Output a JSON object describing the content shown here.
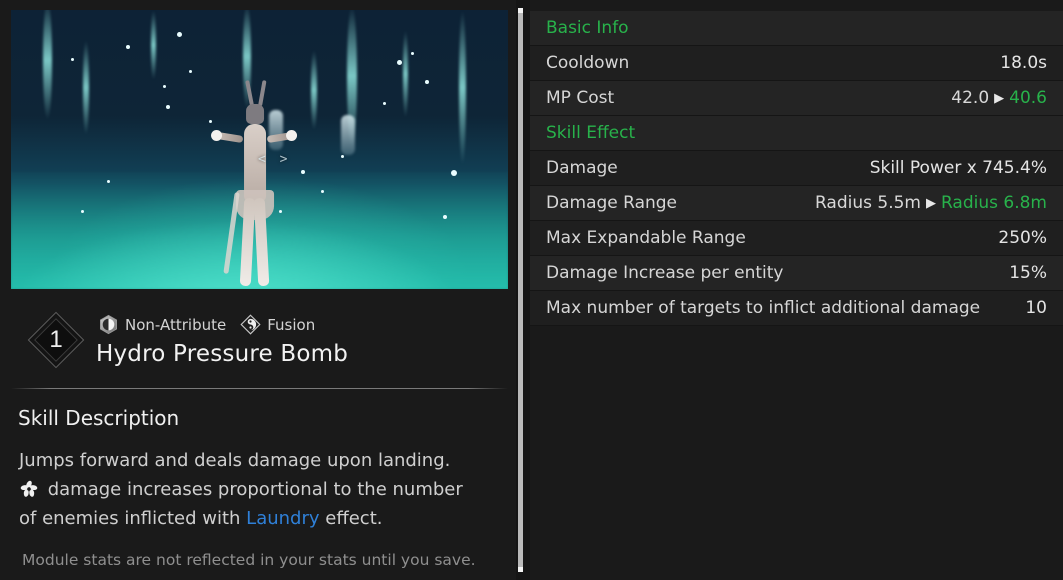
{
  "left": {
    "video": {
      "name": "skill-preview-video",
      "seek_marker": "< >"
    },
    "level_badge": "1",
    "attributes": [
      {
        "icon": "hexagon-non-attribute-icon",
        "label": "Non-Attribute"
      },
      {
        "icon": "diamond-fusion-icon",
        "label": "Fusion"
      }
    ],
    "skill_name": "Hydro Pressure Bomb",
    "description_title": "Skill Description",
    "description_lines": [
      "Jumps forward and deals damage upon landing.",
      "[icon] damage increases proportional to the number",
      "of enemies inflicted with Laundry effect."
    ],
    "description_line_1": "Jumps forward and deals damage upon landing.",
    "description_line_2_after_icon": " damage increases proportional to the number",
    "description_line_3_pre": "of enemies inflicted with ",
    "description_link": "Laundry",
    "description_line_3_post": " effect.",
    "footer_note": "Module stats are not reflected in your stats until you save."
  },
  "right": {
    "sections": [
      {
        "title": "Basic Info",
        "rows": [
          {
            "key": "Cooldown",
            "value": "18.0s",
            "old": null,
            "new": null
          },
          {
            "key": "MP Cost",
            "value": null,
            "old": "42.0",
            "new": "40.6"
          }
        ]
      },
      {
        "title": "Skill Effect",
        "rows": [
          {
            "key": "Damage",
            "value": "Skill Power x 745.4%",
            "old": null,
            "new": null
          },
          {
            "key": "Damage Range",
            "value": null,
            "old": "Radius 5.5m",
            "new": "Radius 6.8m"
          },
          {
            "key": "Max Expandable Range",
            "value": "250%",
            "old": null,
            "new": null
          },
          {
            "key": "Damage Increase per entity",
            "value": "15%",
            "old": null,
            "new": null
          },
          {
            "key": "Max number of targets to inflict additional damage",
            "value": "10",
            "old": null,
            "new": null
          }
        ]
      }
    ],
    "arrow_glyph": "▶"
  },
  "colors": {
    "background": "#1a1a1a",
    "row_shade_a": "#242424",
    "row_shade_b": "#1f1f1f",
    "accent_green": "#28b24b",
    "link_blue": "#2f80d8",
    "text_primary": "#e4e4e4",
    "text_muted": "#8f8f8f"
  }
}
